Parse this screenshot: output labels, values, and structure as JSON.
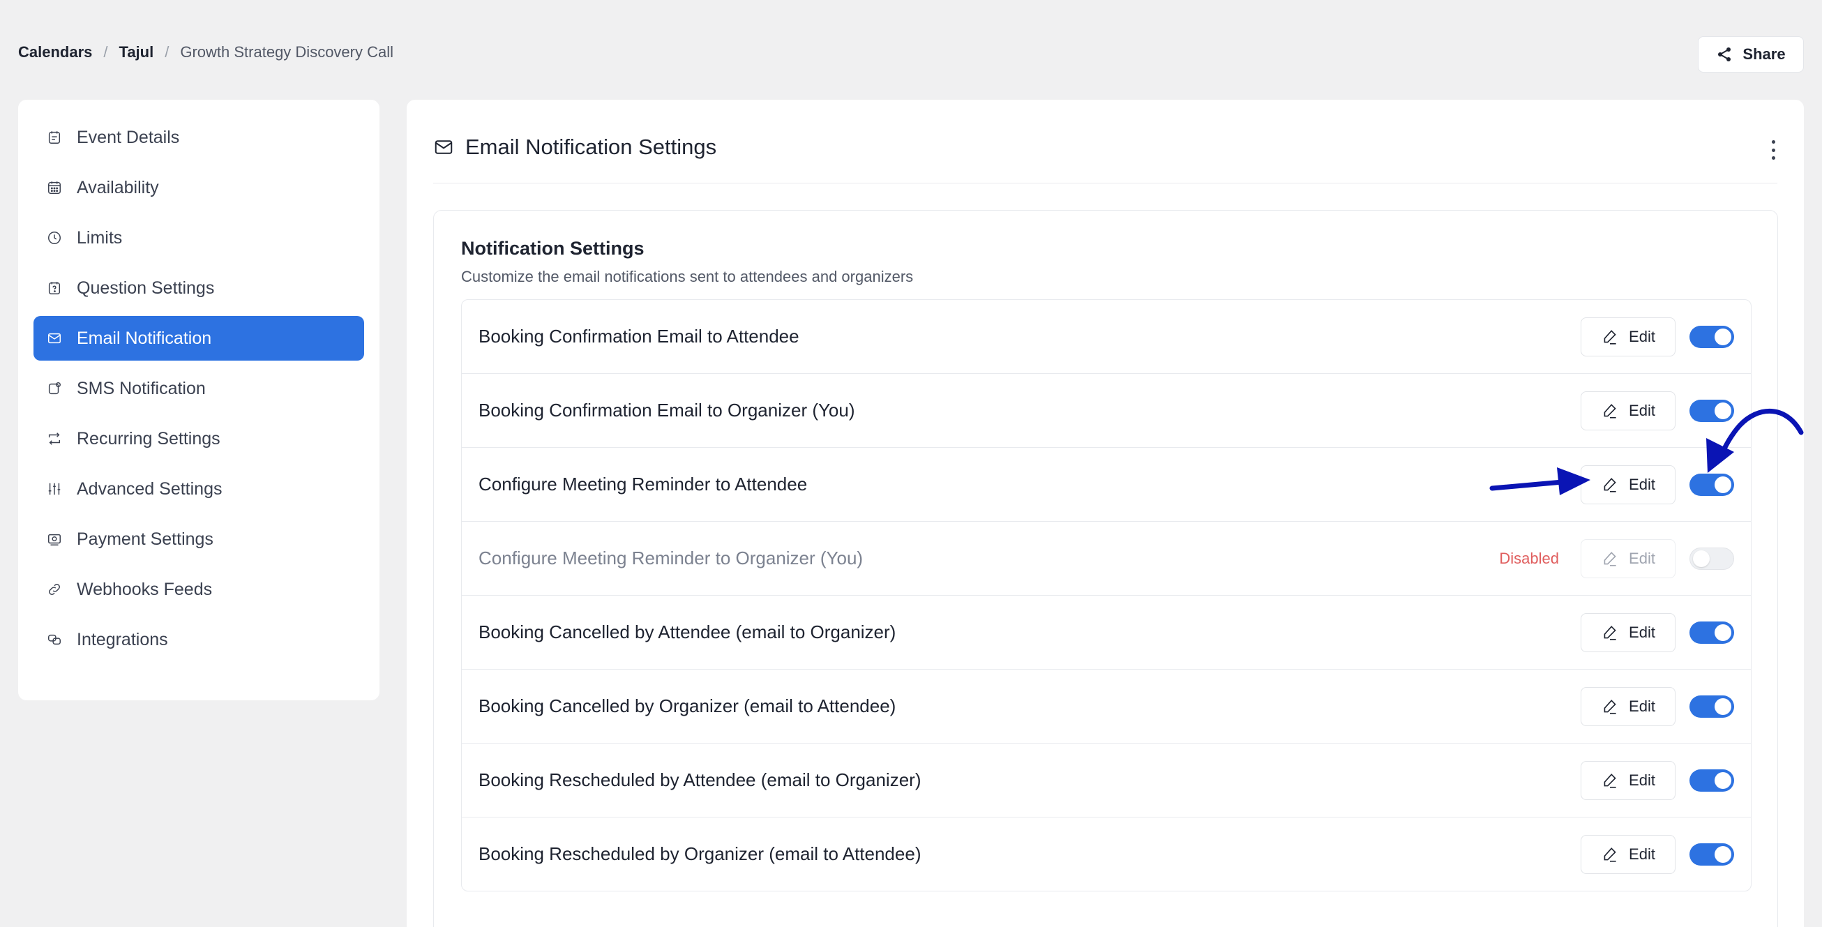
{
  "breadcrumb": {
    "items": [
      "Calendars",
      "Tajul",
      "Growth Strategy Discovery Call"
    ],
    "separator": "/"
  },
  "share": {
    "label": "Share",
    "icon": "share-icon"
  },
  "sidebar": {
    "items": [
      {
        "label": "Event Details",
        "icon": "calendar-lines-icon",
        "active": false
      },
      {
        "label": "Availability",
        "icon": "calendar-grid-icon",
        "active": false
      },
      {
        "label": "Limits",
        "icon": "clock-icon",
        "active": false
      },
      {
        "label": "Question Settings",
        "icon": "question-calendar-icon",
        "active": false
      },
      {
        "label": "Email Notification",
        "icon": "mail-icon",
        "active": true
      },
      {
        "label": "SMS Notification",
        "icon": "sms-icon",
        "active": false
      },
      {
        "label": "Recurring Settings",
        "icon": "repeat-icon",
        "active": false
      },
      {
        "label": "Advanced Settings",
        "icon": "sliders-icon",
        "active": false
      },
      {
        "label": "Payment Settings",
        "icon": "payment-icon",
        "active": false
      },
      {
        "label": "Webhooks Feeds",
        "icon": "link-icon",
        "active": false
      },
      {
        "label": "Integrations",
        "icon": "integrations-icon",
        "active": false
      }
    ]
  },
  "main": {
    "title": "Email Notification Settings",
    "title_icon": "mail-icon",
    "card": {
      "title": "Notification Settings",
      "subtitle": "Customize the email notifications sent to attendees and organizers",
      "edit_label": "Edit",
      "rows": [
        {
          "label": "Booking Confirmation Email to Attendee",
          "enabled": true,
          "status": ""
        },
        {
          "label": "Booking Confirmation Email to Organizer (You)",
          "enabled": true,
          "status": ""
        },
        {
          "label": "Configure Meeting Reminder to Attendee",
          "enabled": true,
          "status": ""
        },
        {
          "label": "Configure Meeting Reminder to Organizer (You)",
          "enabled": false,
          "status": "Disabled"
        },
        {
          "label": "Booking Cancelled by Attendee (email to Organizer)",
          "enabled": true,
          "status": ""
        },
        {
          "label": "Booking Cancelled by Organizer (email to Attendee)",
          "enabled": true,
          "status": ""
        },
        {
          "label": "Booking Rescheduled by Attendee (email to Organizer)",
          "enabled": true,
          "status": ""
        },
        {
          "label": "Booking Rescheduled by Organizer (email to Attendee)",
          "enabled": true,
          "status": ""
        }
      ]
    }
  },
  "colors": {
    "accent": "#2d72e1",
    "background": "#f0f0f1",
    "disabled_text": "#e05e5e",
    "annotation_arrow": "#0a14b4"
  }
}
